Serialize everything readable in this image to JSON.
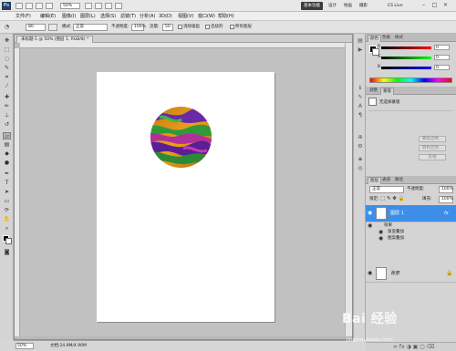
{
  "appbar": {
    "logo": "Ps",
    "zoom": "50%",
    "workspace_buttons": [
      "基本功能",
      "设计",
      "绘画",
      "摄影"
    ],
    "cs_live": "CS Live",
    "window_controls": [
      "–",
      "□",
      "×"
    ]
  },
  "menubar": {
    "items": [
      "文件(F)",
      "编辑(E)",
      "图像(I)",
      "图层(L)",
      "选择(S)",
      "滤镜(T)",
      "分析(A)",
      "3D(D)",
      "视图(V)",
      "窗口(W)",
      "帮助(H)"
    ]
  },
  "options": {
    "brush_size": "80",
    "mode_label": "模式:",
    "mode_value": "正常",
    "opacity_label": "不透明度:",
    "opacity_value": "100%",
    "flow_label": "流量:",
    "flow_value": "50",
    "protect_texture": "消除锯齿",
    "continuous": "连续的",
    "all_layers": "所有图层"
  },
  "document": {
    "tab_title": "未标题-1 @ 50% (图层 1, RGB/8) *",
    "status_zoom": "50%",
    "status_doc": "文档:24.9M/4.90M"
  },
  "color_panel": {
    "tabs": [
      "颜色",
      "色板",
      "样式"
    ],
    "r_label": "R",
    "g_label": "G",
    "b_label": "B",
    "r_value": "0",
    "g_value": "0",
    "b_value": "0"
  },
  "adjust_panel": {
    "tabs": [
      "调整",
      "蒙版"
    ],
    "title": "无选择蒙版",
    "buttons": [
      "蒙版边缘...",
      "颜色范围...",
      "反相"
    ]
  },
  "layers_panel": {
    "tabs": [
      "图层",
      "通道",
      "路径"
    ],
    "blend_mode": "正常",
    "opacity_label": "不透明度:",
    "opacity_value": "100%",
    "lock_label": "锁定:",
    "fill_label": "填充:",
    "fill_value": "100%",
    "layers": [
      {
        "name": "图层 1",
        "selected": true,
        "fx": "fx"
      },
      {
        "name": "背景",
        "selected": false
      }
    ],
    "effects_label": "效果",
    "effects": [
      "渐变叠加",
      "图案叠加"
    ]
  },
  "watermark": {
    "text": "Bai 经验",
    "url": "jingyan.baidu.com"
  },
  "colors": {
    "selection": "#3d8ee8",
    "foreground": "#000000",
    "background": "#ffffff"
  }
}
